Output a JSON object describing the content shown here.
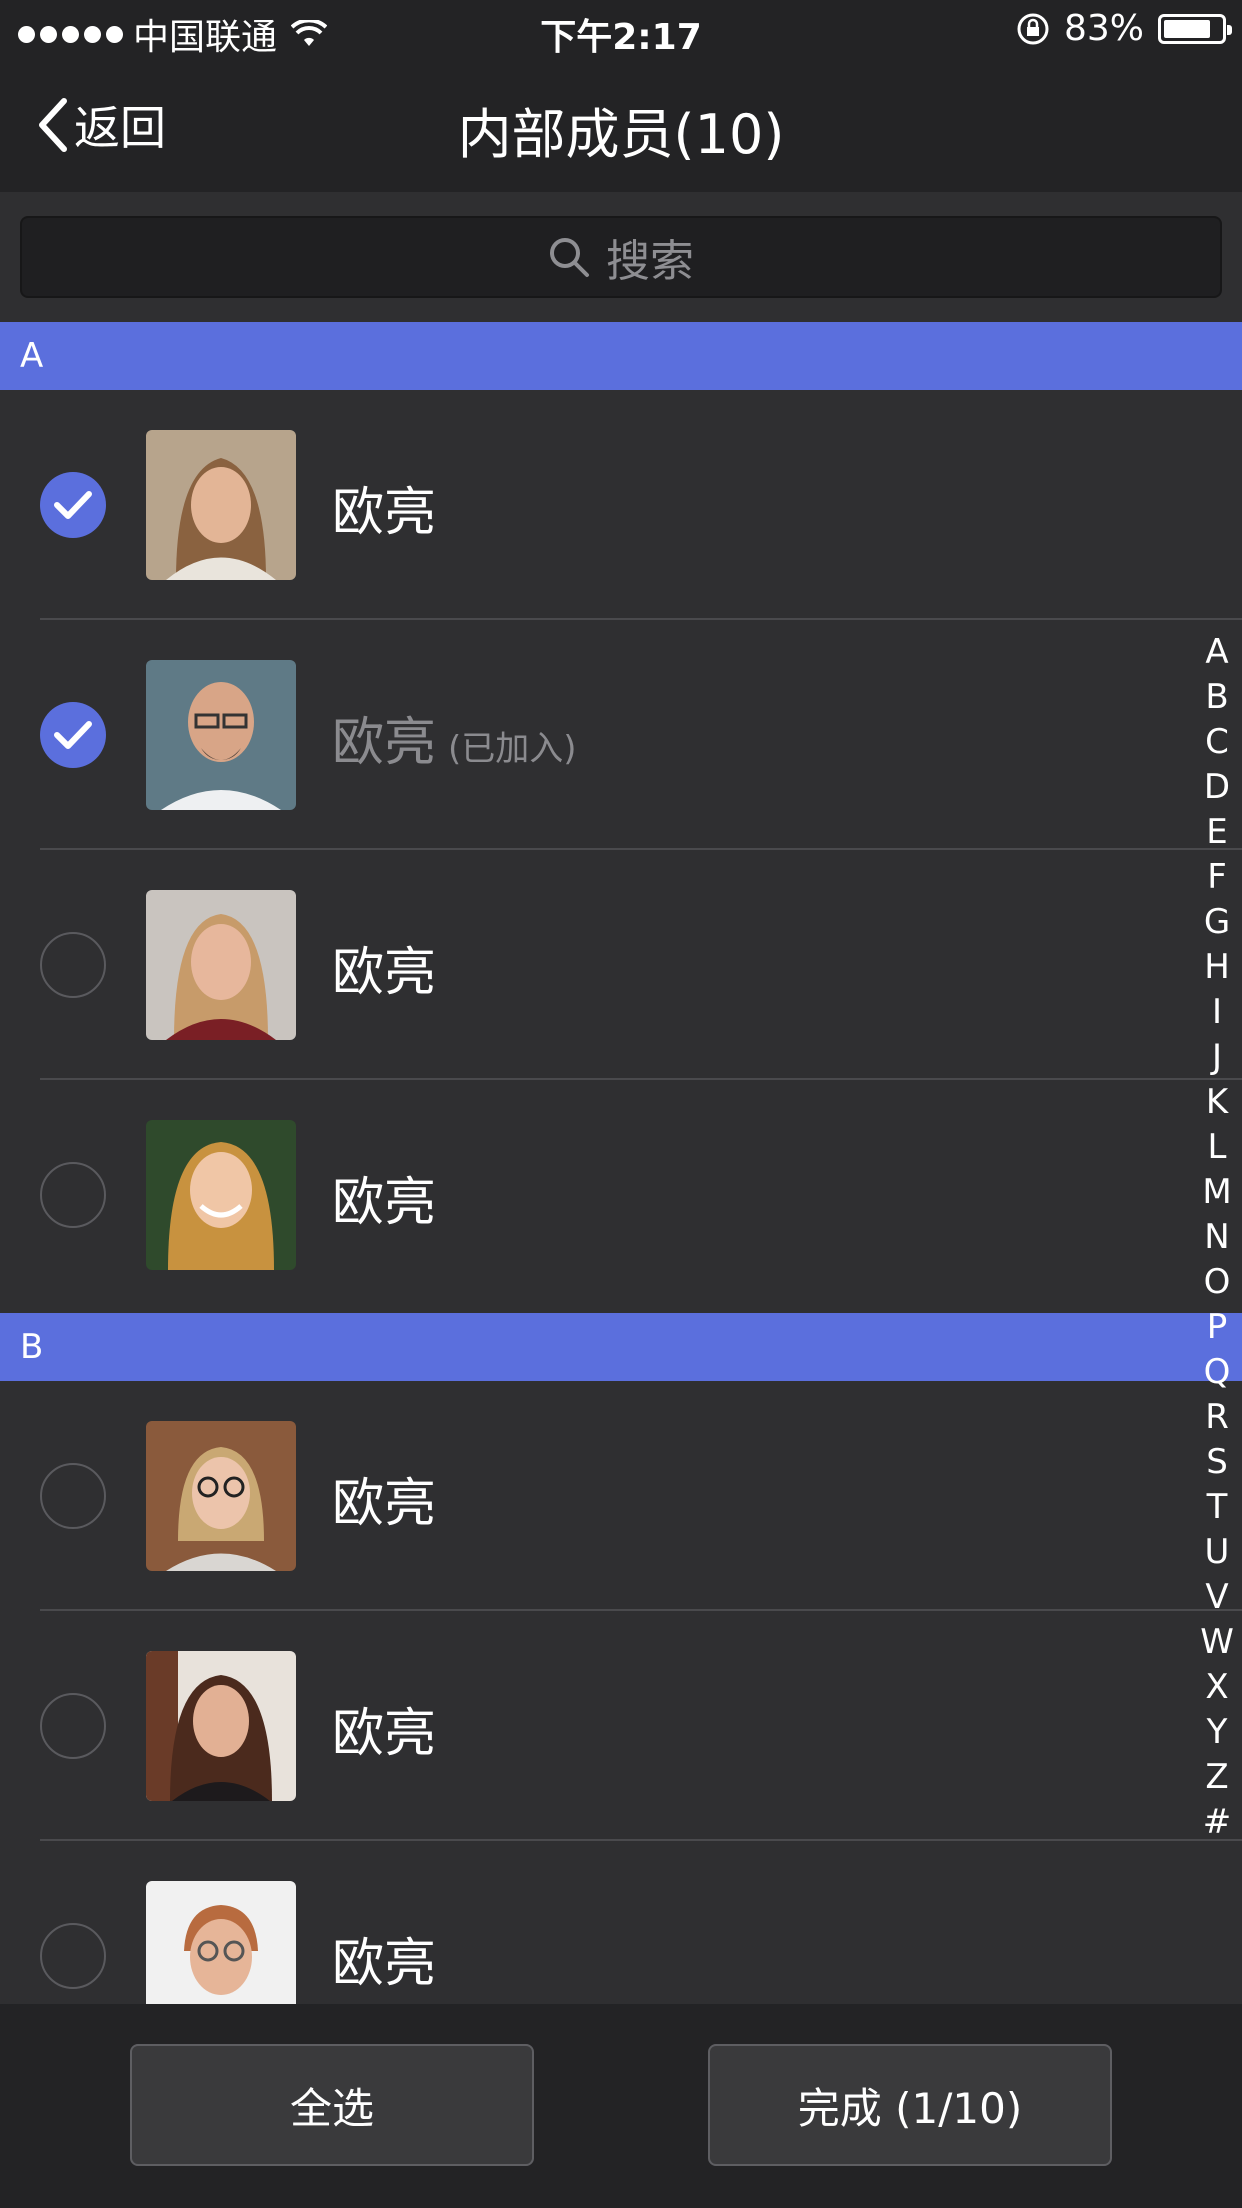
{
  "status_bar": {
    "carrier": "中国联通",
    "time": "下午2:17",
    "battery_percent": "83%",
    "battery_level": 0.83,
    "icons": [
      "signal-dots-icon",
      "wifi-icon",
      "rotation-lock-icon",
      "battery-icon"
    ]
  },
  "nav": {
    "back_label": "返回",
    "title": "内部成员(10)"
  },
  "search": {
    "placeholder": "搜索"
  },
  "sections": [
    {
      "letter": "A",
      "members": [
        {
          "name": "欧亮",
          "checked": true,
          "note": ""
        },
        {
          "name": "欧亮",
          "checked": true,
          "note": "(已加入)"
        },
        {
          "name": "欧亮",
          "checked": false,
          "note": ""
        },
        {
          "name": "欧亮",
          "checked": false,
          "note": ""
        }
      ]
    },
    {
      "letter": "B",
      "members": [
        {
          "name": "欧亮",
          "checked": false,
          "note": ""
        },
        {
          "name": "欧亮",
          "checked": false,
          "note": ""
        },
        {
          "name": "欧亮",
          "checked": false,
          "note": ""
        }
      ]
    }
  ],
  "index_letters": [
    "A",
    "B",
    "C",
    "D",
    "E",
    "F",
    "G",
    "H",
    "I",
    "J",
    "K",
    "L",
    "M",
    "N",
    "O",
    "P",
    "Q",
    "R",
    "S",
    "T",
    "U",
    "V",
    "W",
    "X",
    "Y",
    "Z",
    "#"
  ],
  "toolbar": {
    "select_all_label": "全选",
    "done_label": "完成 (1/10)"
  },
  "colors": {
    "accent": "#5b6fdd",
    "background": "#2f2f31",
    "bar": "#232325"
  }
}
